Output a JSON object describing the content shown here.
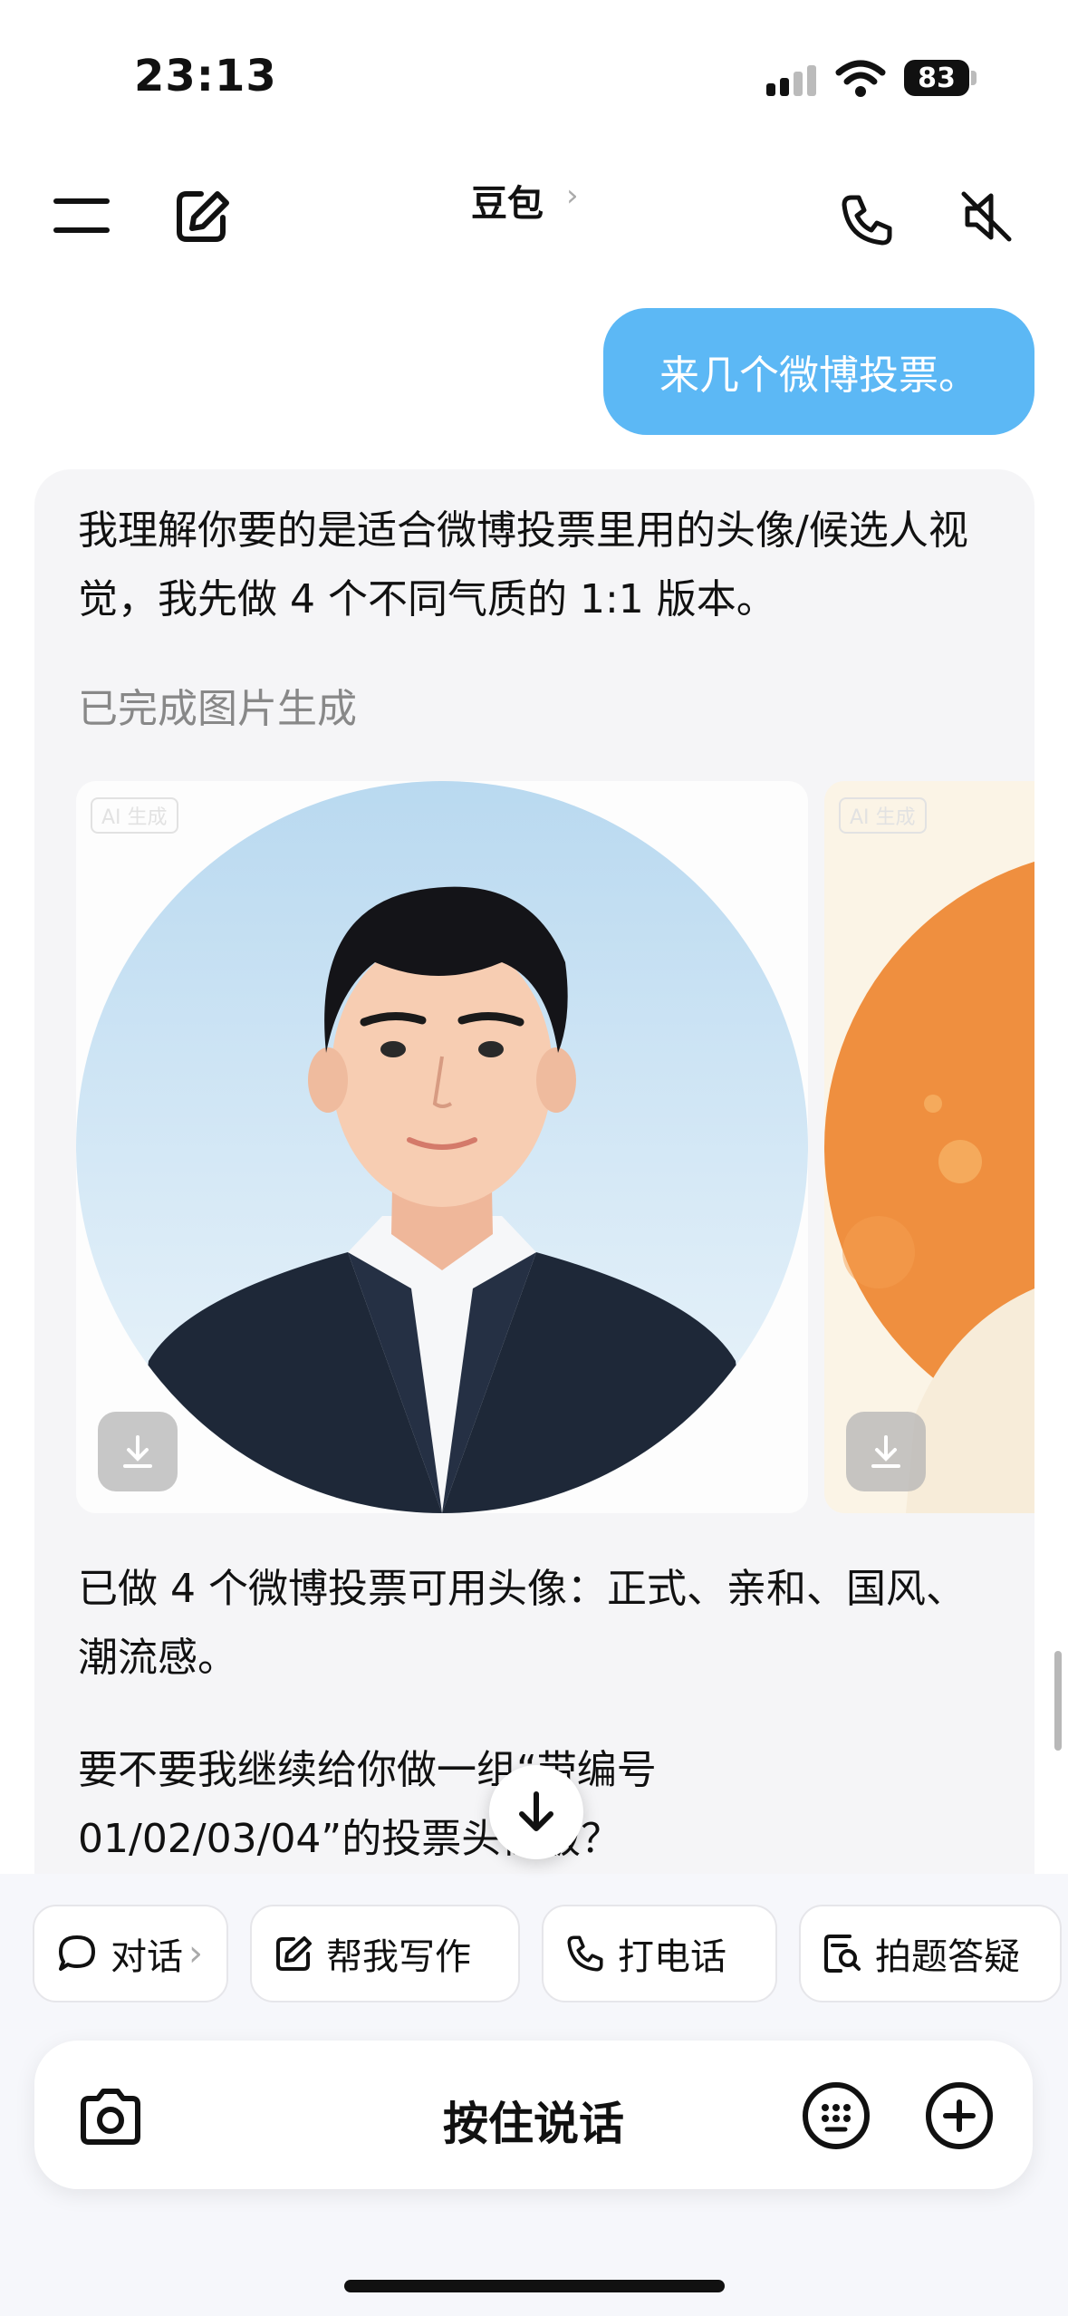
{
  "status_bar": {
    "time": "23:13",
    "battery": "83",
    "icons": [
      "cellular-signal-icon",
      "wifi-icon",
      "battery-icon"
    ]
  },
  "header": {
    "title": "豆包",
    "title_chevron": "›",
    "icons": [
      "menu-icon",
      "new-chat-icon",
      "phone-icon",
      "speaker-mute-icon"
    ]
  },
  "chat": {
    "user_message": "来几个微博投票。",
    "assistant": {
      "intro": "我理解你要的是适合微博投票里用的头像/候选人视觉，我先做 4 个不同气质的 1:1 版本。",
      "status": "已完成图片生成",
      "image_tag": "AI 生成",
      "summary": "已做 4 个微博投票可用头像：正式、亲和、国风、潮流感。",
      "followup": "要不要我继续给你做一组“带编号 01/02/03/04”的投票头像版？"
    }
  },
  "quick_actions": [
    {
      "label": "对话",
      "icon": "chat-bubble-icon",
      "chevron": "›"
    },
    {
      "label": "帮我写作",
      "icon": "edit-icon"
    },
    {
      "label": "打电话",
      "icon": "phone-icon"
    },
    {
      "label": "拍题答疑",
      "icon": "doc-search-icon"
    }
  ],
  "input_bar": {
    "hold_to_talk": "按住说话",
    "icons": [
      "camera-icon",
      "keyboard-icon",
      "plus-icon"
    ]
  },
  "colors": {
    "user_bubble": "#5cb8f5",
    "card_bg": "#f5f5f7",
    "bottom_bg": "#f6f7fb"
  }
}
